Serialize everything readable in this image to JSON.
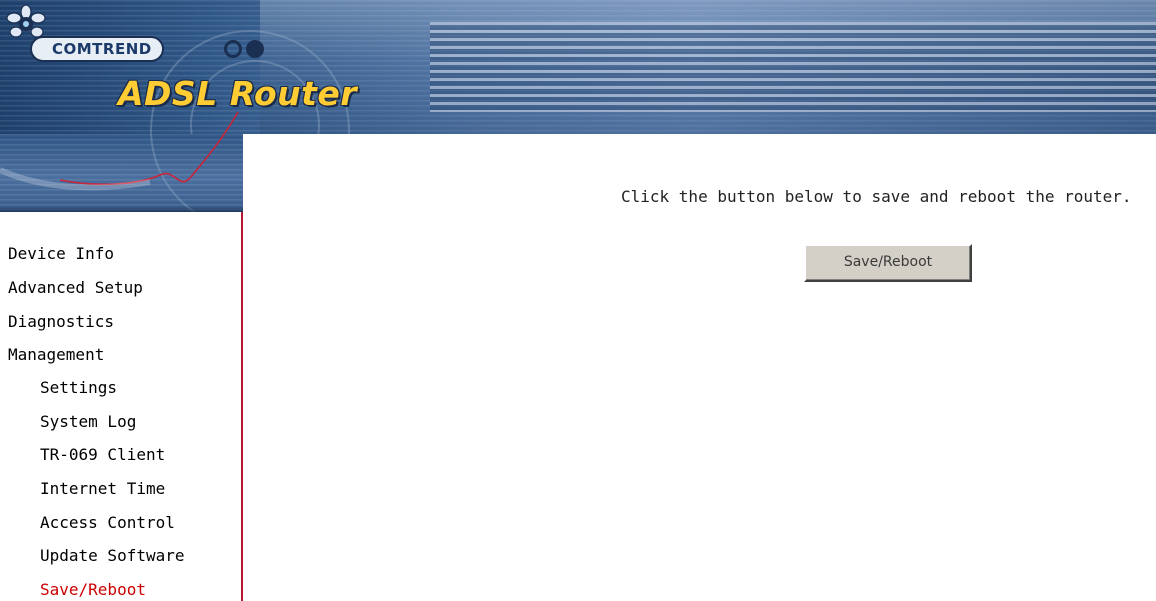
{
  "header": {
    "brand": "COMTREND",
    "product": "ADSL Router"
  },
  "sidebar": {
    "items": [
      {
        "label": "Device Info",
        "level": 0,
        "active": false
      },
      {
        "label": "Advanced Setup",
        "level": 0,
        "active": false
      },
      {
        "label": "Diagnostics",
        "level": 0,
        "active": false
      },
      {
        "label": "Management",
        "level": 0,
        "active": false
      },
      {
        "label": "Settings",
        "level": 1,
        "active": false
      },
      {
        "label": "System Log",
        "level": 1,
        "active": false
      },
      {
        "label": "TR-069 Client",
        "level": 1,
        "active": false
      },
      {
        "label": "Internet Time",
        "level": 1,
        "active": false
      },
      {
        "label": "Access Control",
        "level": 1,
        "active": false
      },
      {
        "label": "Update Software",
        "level": 1,
        "active": false
      },
      {
        "label": "Save/Reboot",
        "level": 1,
        "active": true
      }
    ]
  },
  "main": {
    "instruction": "Click the button below to save and reboot the router.",
    "button_label": "Save/Reboot"
  },
  "colors": {
    "active_menu": "#cc0000",
    "sidebar_border": "#b51a35",
    "banner_blue": "#2f5787",
    "title_gold": "#ffcc33"
  }
}
